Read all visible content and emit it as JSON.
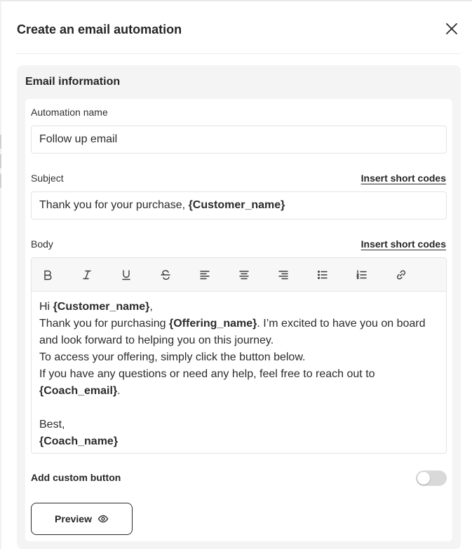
{
  "modal": {
    "title": "Create an email automation"
  },
  "email_info": {
    "section_title": "Email information",
    "automation_name_label": "Automation name",
    "automation_name_value": "Follow up email",
    "subject_label": "Subject",
    "insert_short_codes": "Insert short codes",
    "subject_prefix": "Thank you for your purchase, ",
    "subject_code": "{Customer_name}",
    "body_label": "Body",
    "toolbar": [
      "bold-icon",
      "italic-icon",
      "underline-icon",
      "strikethrough-icon",
      "align-left-icon",
      "align-center-icon",
      "align-right-icon",
      "bullet-list-icon",
      "numbered-list-icon",
      "link-icon"
    ],
    "body": {
      "l1_a": "Hi ",
      "l1_code": "{Customer_name}",
      "l1_b": ",",
      "l2_a": "Thank you for purchasing ",
      "l2_code": "{Offering_name}",
      "l2_b": ". I’m excited to have you on board and look forward to helping you on this journey.",
      "l3": "To access your offering, simply click the button below.",
      "l4": "If you have any questions or need any help, feel free to reach out to ",
      "l4_code": "{Coach_email}",
      "l4_b": ".",
      "sign_off": "Best,",
      "coach_code": "{Coach_name}"
    },
    "add_custom_button_label": "Add custom button",
    "custom_button_enabled": false,
    "preview_label": "Preview"
  }
}
